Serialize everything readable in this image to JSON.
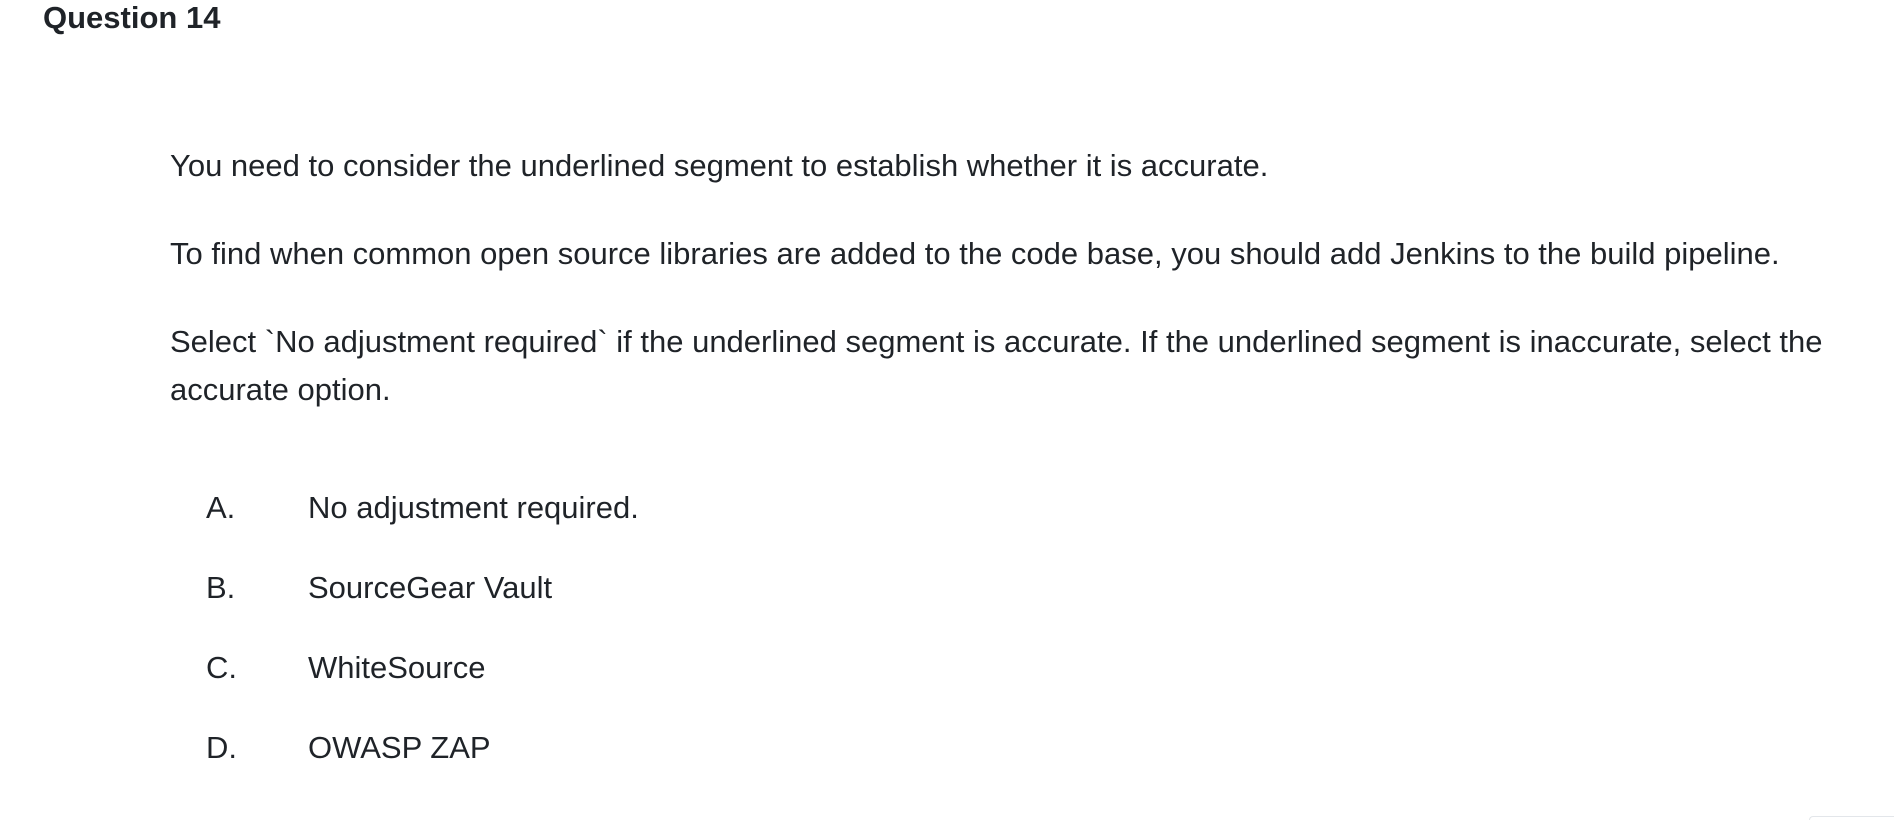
{
  "question": {
    "title": "Question 14",
    "paragraphs": [
      "You need to consider the underlined segment to establish whether it is accurate.",
      "To find when common open source libraries are added to the code base, you should add Jenkins to the build pipeline.",
      "Select `No adjustment required` if the underlined segment is accurate. If the underlined segment is inaccurate, select the accurate option."
    ],
    "options": [
      {
        "letter": "A.",
        "text": "No adjustment required."
      },
      {
        "letter": "B.",
        "text": "SourceGear Vault"
      },
      {
        "letter": "C.",
        "text": "WhiteSource"
      },
      {
        "letter": "D.",
        "text": "OWASP ZAP"
      }
    ]
  }
}
